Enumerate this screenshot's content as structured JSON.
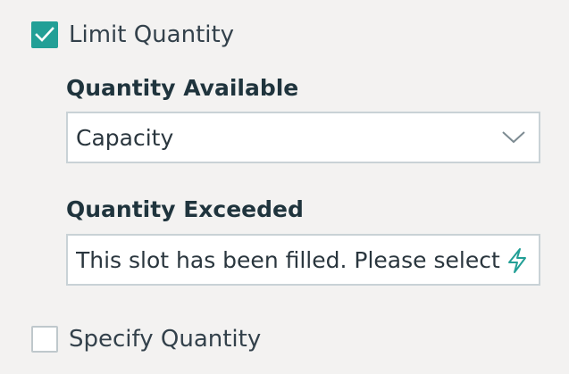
{
  "limit_quantity": {
    "label": "Limit Quantity",
    "checked": true
  },
  "quantity_available": {
    "label": "Quantity Available",
    "selected_value": "Capacity"
  },
  "quantity_exceeded": {
    "label": "Quantity Exceeded",
    "value": "This slot has been filled. Please select a"
  },
  "specify_quantity": {
    "label": "Specify Quantity",
    "checked": false
  },
  "icons": {
    "checkbox_check": "check-icon",
    "select_chevron": "chevron-down-icon",
    "text_action": "lightning-bolt-icon"
  },
  "colors": {
    "accent": "#229f96",
    "background": "#f3f2f1",
    "text": "#33414b",
    "border": "#c9d2d6"
  }
}
